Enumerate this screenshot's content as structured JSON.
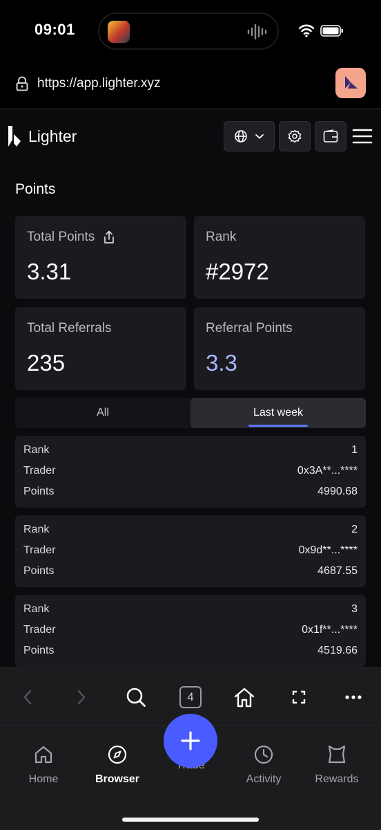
{
  "status_bar": {
    "time": "09:01"
  },
  "browser": {
    "url": "https://app.lighter.xyz",
    "tab_count": "4"
  },
  "header": {
    "brand": "Lighter"
  },
  "page": {
    "title": "Points"
  },
  "stats": [
    {
      "label": "Total Points",
      "value": "3.31"
    },
    {
      "label": "Rank",
      "value": "#2972"
    },
    {
      "label": "Total Referrals",
      "value": "235"
    },
    {
      "label": "Referral Points",
      "value": "3.3"
    }
  ],
  "tabs": [
    {
      "label": "All"
    },
    {
      "label": "Last week"
    }
  ],
  "leaderboard": {
    "labels": {
      "rank": "Rank",
      "trader": "Trader",
      "points": "Points"
    },
    "rows": [
      {
        "rank": "1",
        "trader": "0x3A**...****",
        "points": "4990.68"
      },
      {
        "rank": "2",
        "trader": "0x9d**...****",
        "points": "4687.55"
      },
      {
        "rank": "3",
        "trader": "0x1f**...****",
        "points": "4519.66"
      }
    ]
  },
  "bottom_nav": [
    {
      "label": "Home"
    },
    {
      "label": "Browser"
    },
    {
      "label": "Trade"
    },
    {
      "label": "Activity"
    },
    {
      "label": "Rewards"
    }
  ],
  "colors": {
    "accent": "#4a5cff",
    "referral_points": "#a6b6ff",
    "site_logo": "#f5a58c"
  }
}
